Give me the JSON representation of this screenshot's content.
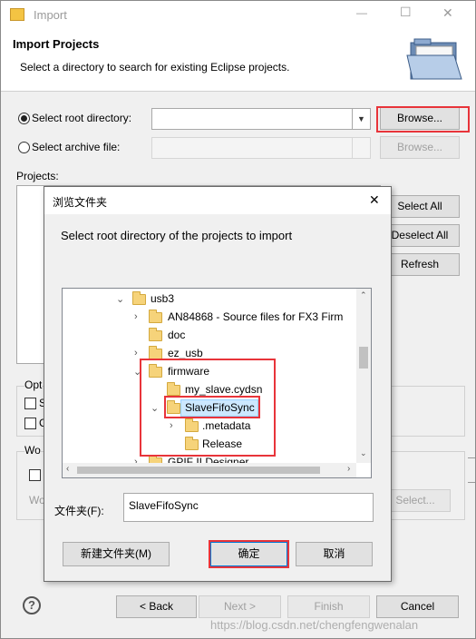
{
  "import_window": {
    "title": "Import",
    "minimize_glyph": "—",
    "maximize_glyph": "☐",
    "close_glyph": "✕",
    "header_title": "Import Projects",
    "header_subtitle": "Select a directory to search for existing Eclipse projects.",
    "root_dir_label": "Select root directory:",
    "root_dir_value": "",
    "root_browse": "Browse...",
    "archive_label": "Select archive file:",
    "archive_value": "",
    "archive_browse": "Browse...",
    "projects_label": "Projects:",
    "select_all": "Select All",
    "deselect_all": "Deselect All",
    "refresh": "Refresh",
    "options_label": "Opt",
    "option1": "S",
    "option2": "C",
    "working_sets_label": "Wo",
    "working_sets_sub": "Wo",
    "ws_select": "Select...",
    "help_glyph": "?",
    "back": "< Back",
    "next": "Next >",
    "finish": "Finish",
    "cancel": "Cancel"
  },
  "browse_dialog": {
    "title": "浏览文件夹",
    "close_glyph": "✕",
    "prompt": "Select root directory of the projects to import",
    "tree": [
      {
        "label": "usb3",
        "expanded": true
      },
      {
        "label": "AN84868 - Source files for FX3 Firm",
        "expanded": false
      },
      {
        "label": "doc",
        "expanded": null
      },
      {
        "label": "ez_usb",
        "expanded": false
      },
      {
        "label": "firmware",
        "expanded": true
      },
      {
        "label": "my_slave.cydsn",
        "expanded": null
      },
      {
        "label": "SlaveFifoSync",
        "expanded": true,
        "selected": true
      },
      {
        "label": ".metadata",
        "expanded": false
      },
      {
        "label": "Release",
        "expanded": null
      },
      {
        "label": "GPIF II Designer",
        "expanded": false
      }
    ],
    "folder_label": "文件夹(F):",
    "folder_value": "SlaveFifoSync",
    "new_folder": "新建文件夹(M)",
    "ok": "确定",
    "cancel": "取消"
  },
  "watermark": "https://blog.csdn.net/chengfengwenalan"
}
